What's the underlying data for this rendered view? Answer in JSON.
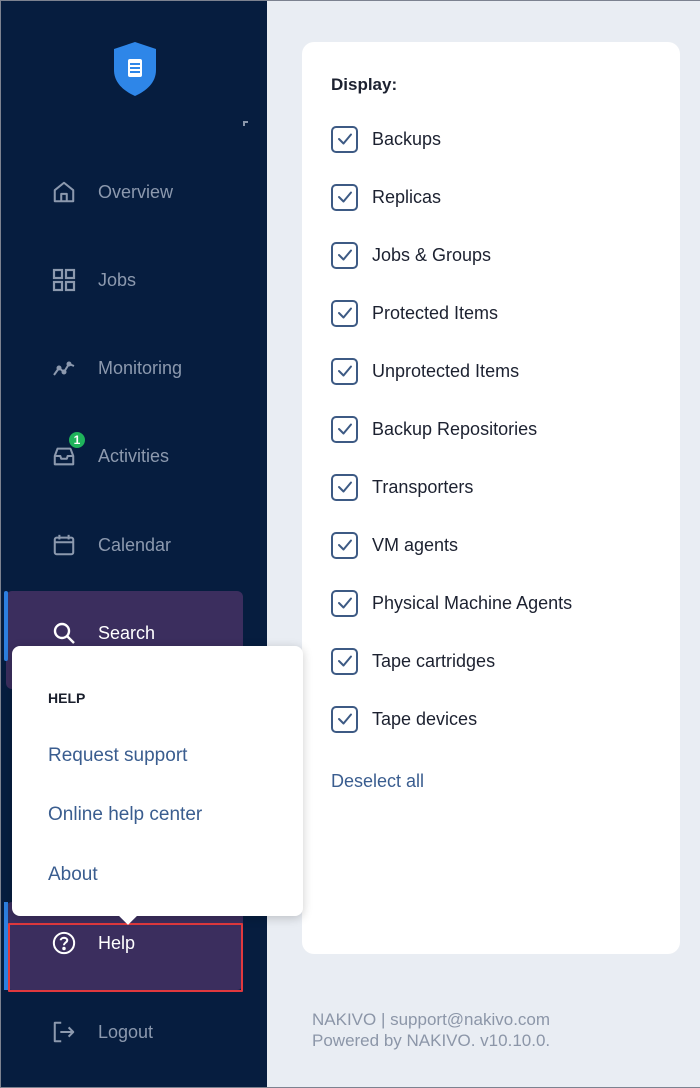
{
  "sidebar": {
    "items": [
      {
        "label": "Overview",
        "icon": "home-icon"
      },
      {
        "label": "Jobs",
        "icon": "grid-icon"
      },
      {
        "label": "Monitoring",
        "icon": "monitoring-icon"
      },
      {
        "label": "Activities",
        "icon": "inbox-icon",
        "badge": "1"
      },
      {
        "label": "Calendar",
        "icon": "calendar-icon"
      },
      {
        "label": "Search",
        "icon": "search-icon"
      },
      {
        "label": "Help",
        "icon": "help-icon"
      },
      {
        "label": "Logout",
        "icon": "logout-icon"
      }
    ],
    "active": "Search"
  },
  "help_menu": {
    "title": "HELP",
    "links": [
      "Request support",
      "Online help center",
      "About"
    ]
  },
  "display": {
    "title": "Display:",
    "options": [
      {
        "label": "Backups",
        "checked": true
      },
      {
        "label": "Replicas",
        "checked": true
      },
      {
        "label": "Jobs & Groups",
        "checked": true
      },
      {
        "label": "Protected Items",
        "checked": true
      },
      {
        "label": "Unprotected Items",
        "checked": true
      },
      {
        "label": "Backup Repositories",
        "checked": true
      },
      {
        "label": "Transporters",
        "checked": true
      },
      {
        "label": "VM agents",
        "checked": true
      },
      {
        "label": "Physical Machine Agents",
        "checked": true
      },
      {
        "label": "Tape cartridges",
        "checked": true
      },
      {
        "label": "Tape devices",
        "checked": true
      }
    ],
    "deselect_label": "Deselect all"
  },
  "footer": {
    "line1": "NAKIVO | support@nakivo.com",
    "line2": "Powered by NAKIVO. v10.10.0."
  },
  "colors": {
    "sidebar_bg": "#061d3f",
    "active_bg": "#3b2e5e",
    "accent": "#2d7fe0",
    "badge": "#1fb35b",
    "highlight_outline": "#e0393e"
  }
}
